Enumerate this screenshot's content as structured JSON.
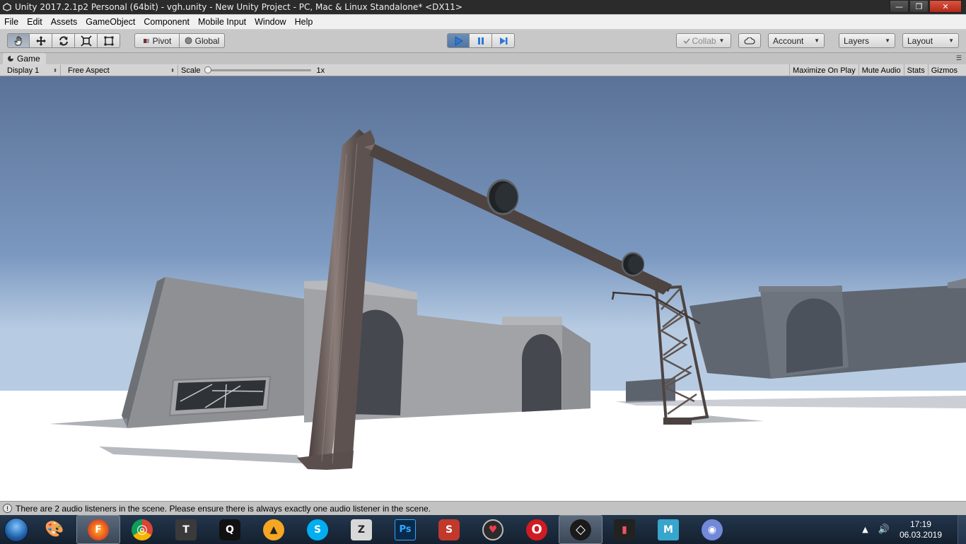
{
  "window": {
    "title": "Unity 2017.2.1p2 Personal (64bit) - vgh.unity - New Unity Project - PC, Mac & Linux Standalone* <DX11>",
    "minimize": "—",
    "maximize": "❐",
    "close": "✕"
  },
  "menu": {
    "items": [
      {
        "label": "File"
      },
      {
        "label": "Edit"
      },
      {
        "label": "Assets"
      },
      {
        "label": "GameObject"
      },
      {
        "label": "Component"
      },
      {
        "label": "Mobile Input"
      },
      {
        "label": "Window"
      },
      {
        "label": "Help"
      }
    ]
  },
  "toolbar": {
    "pivot": "Pivot",
    "global": "Global",
    "collab": "Collab",
    "account": "Account",
    "layers": "Layers",
    "layout": "Layout",
    "caret": "▼",
    "play_state": "playing"
  },
  "game_tab": {
    "label": "Game",
    "menu": "☰"
  },
  "game_toolbar": {
    "display": "Display 1",
    "aspect": "Free Aspect",
    "scale_label": "Scale",
    "scale_value": "1x",
    "maximize_on_play": "Maximize On Play",
    "mute_audio": "Mute Audio",
    "stats": "Stats",
    "gizmos": "Gizmos",
    "arrows": "⬍"
  },
  "status": {
    "icon": "!",
    "message": "There are 2 audio listeners in the scene. Please ensure there is always exactly one audio listener in the scene."
  },
  "taskbar": {
    "apps": [
      {
        "name": "paint",
        "glyph": "🎨"
      },
      {
        "name": "firefox",
        "glyph": "F"
      },
      {
        "name": "chrome",
        "glyph": "◎"
      },
      {
        "name": "world-of-tanks",
        "glyph": "T"
      },
      {
        "name": "quixel",
        "glyph": "Q"
      },
      {
        "name": "artstation",
        "glyph": "▲"
      },
      {
        "name": "skype",
        "glyph": "S"
      },
      {
        "name": "zbrush",
        "glyph": "Z"
      },
      {
        "name": "photoshop",
        "glyph": "Ps"
      },
      {
        "name": "substance-painter",
        "glyph": "S"
      },
      {
        "name": "marmoset",
        "glyph": "♥"
      },
      {
        "name": "opera",
        "glyph": "O"
      },
      {
        "name": "unity",
        "glyph": "◇"
      },
      {
        "name": "deezer",
        "glyph": "▮"
      },
      {
        "name": "maya",
        "glyph": "M"
      },
      {
        "name": "discord",
        "glyph": "◉"
      }
    ],
    "tray_arrow": "▲",
    "volume": "🔊",
    "time": "17:19",
    "date": "06.03.2019"
  },
  "colors": {
    "sky_top": "#5b7297",
    "sky_bottom": "#b7cce3",
    "ground": "#ffffff",
    "building": "#8e9094",
    "metal": "#5a4f4d",
    "play_active": "#4f76a4"
  }
}
